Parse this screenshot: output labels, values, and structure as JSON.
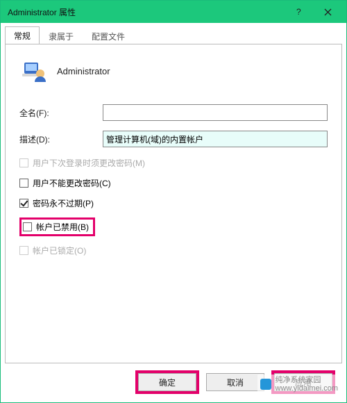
{
  "window": {
    "title": "Administrator 属性"
  },
  "tabs": {
    "general": "常规",
    "memberof": "隶属于",
    "profile": "配置文件"
  },
  "user": {
    "name": "Administrator"
  },
  "fields": {
    "fullname_label": "全名(F):",
    "fullname_value": "",
    "description_label": "描述(D):",
    "description_value": "管理计算机(域)的内置帐户"
  },
  "checks": {
    "must_change": "用户下次登录时须更改密码(M)",
    "cannot_change": "用户不能更改密码(C)",
    "never_expires": "密码永不过期(P)",
    "disabled": "帐户已禁用(B)",
    "locked": "帐户已锁定(O)"
  },
  "buttons": {
    "ok": "确定",
    "cancel": "取消",
    "apply": "应用"
  },
  "watermark": {
    "name": "纯净系统家园",
    "url": "www.yidaimei.com"
  }
}
